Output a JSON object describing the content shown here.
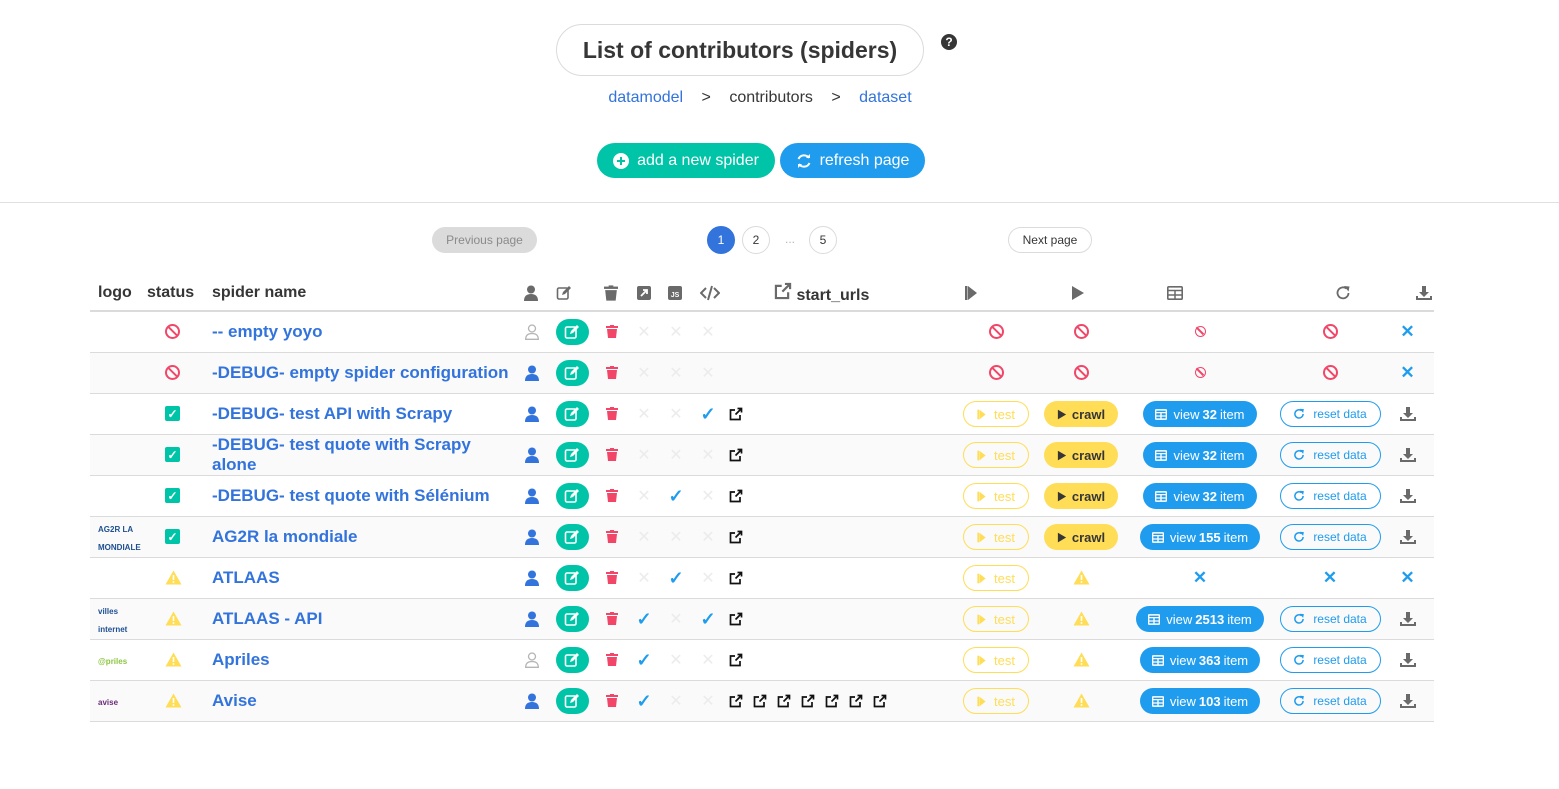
{
  "header": {
    "title": "List of contributors (spiders)",
    "help_icon": "question-circle-icon",
    "breadcrumb": [
      {
        "label": "datamodel",
        "link": true
      },
      {
        "label": "contributors",
        "link": false
      },
      {
        "label": "dataset",
        "link": true
      }
    ],
    "breadcrumb_sep": ">",
    "add_button": "add a new spider",
    "refresh_button": "refresh page"
  },
  "pagination": {
    "previous": "Previous page",
    "next": "Next page",
    "pages": [
      "1",
      "2",
      "5"
    ],
    "ellipsis": "...",
    "current": "1"
  },
  "table": {
    "columns": {
      "logo": "logo",
      "status": "status",
      "name": "spider name",
      "start_urls": "start_urls"
    },
    "header_icons": [
      "user-icon",
      "edit-icon",
      "trash-icon",
      "external-image-icon",
      "js-icon",
      "code-icon",
      "external-link-icon",
      "step-forward-icon",
      "play-icon",
      "table-icon",
      "redo-icon",
      "download-icon"
    ],
    "labels": {
      "test": "test",
      "crawl": "crawl",
      "view_prefix": "view",
      "view_suffix": "item",
      "reset": "reset data"
    },
    "rows": [
      {
        "logo": "",
        "status": "disabled",
        "name": "-- empty yoyo",
        "user": "outline",
        "api": false,
        "selenium": false,
        "scroll": false,
        "urls": 0,
        "run": "disabled",
        "items": null,
        "state": "disabled"
      },
      {
        "logo": "",
        "status": "disabled",
        "name": "-DEBUG- empty spider configuration",
        "user": "solid",
        "api": false,
        "selenium": false,
        "scroll": false,
        "urls": 0,
        "run": "disabled",
        "items": null,
        "state": "disabled"
      },
      {
        "logo": "",
        "status": "ok",
        "name": "-DEBUG- test API with Scrapy",
        "user": "solid",
        "api": false,
        "selenium": false,
        "scroll": true,
        "urls": 1,
        "run": "crawl",
        "items": "32",
        "state": "ok"
      },
      {
        "logo": "",
        "status": "ok",
        "name": "-DEBUG- test quote with Scrapy alone",
        "user": "solid",
        "api": false,
        "selenium": false,
        "scroll": false,
        "urls": 1,
        "run": "crawl",
        "items": "32",
        "state": "ok"
      },
      {
        "logo": "",
        "status": "ok",
        "name": "-DEBUG- test quote with Sélénium",
        "user": "solid",
        "api": false,
        "selenium": true,
        "scroll": false,
        "urls": 1,
        "run": "crawl",
        "items": "32",
        "state": "ok"
      },
      {
        "logo": "AG2R LA MONDIALE",
        "status": "ok",
        "name": "AG2R la mondiale",
        "user": "solid",
        "api": false,
        "selenium": false,
        "scroll": false,
        "urls": 1,
        "run": "crawl",
        "items": "155",
        "state": "ok"
      },
      {
        "logo": "",
        "status": "warning",
        "name": "ATLAAS",
        "user": "solid",
        "api": false,
        "selenium": true,
        "scroll": false,
        "urls": 1,
        "run": "warning",
        "items": null,
        "state": "error"
      },
      {
        "logo": "villes internet",
        "status": "warning",
        "name": "ATLAAS - API",
        "user": "solid",
        "api": true,
        "selenium": false,
        "scroll": true,
        "urls": 1,
        "run": "warning",
        "items": "2513",
        "state": "ok"
      },
      {
        "logo": "@priles",
        "status": "warning",
        "name": "Apriles",
        "user": "outline",
        "api": true,
        "selenium": false,
        "scroll": false,
        "urls": 1,
        "run": "warning",
        "items": "363",
        "state": "ok"
      },
      {
        "logo": "avise",
        "status": "warning",
        "name": "Avise",
        "user": "solid",
        "api": true,
        "selenium": false,
        "scroll": false,
        "urls": 7,
        "run": "warning",
        "items": "103",
        "state": "ok"
      }
    ]
  },
  "colors": {
    "primary": "#3273dc",
    "info": "#209cee",
    "success": "#00c4a7",
    "warning": "#ffdd57",
    "danger": "#f14668"
  }
}
